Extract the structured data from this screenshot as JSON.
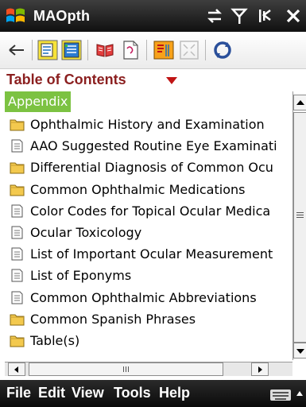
{
  "app": {
    "title": "MAOpth"
  },
  "toc": {
    "heading": "Table of Contents"
  },
  "list": {
    "selected": "Appendix",
    "items": [
      {
        "label": "Ophthalmic History and Examination",
        "icon": "folder-icon"
      },
      {
        "label": "AAO Suggested Routine Eye Examinati",
        "icon": "document-icon"
      },
      {
        "label": "Differential Diagnosis of Common Ocu",
        "icon": "folder-icon"
      },
      {
        "label": "Common Ophthalmic Medications",
        "icon": "folder-icon"
      },
      {
        "label": "Color Codes for Topical Ocular Medica",
        "icon": "document-icon"
      },
      {
        "label": "Ocular Toxicology",
        "icon": "document-icon"
      },
      {
        "label": "List of Important Ocular Measurement",
        "icon": "document-icon"
      },
      {
        "label": "List of Eponyms",
        "icon": "document-icon"
      },
      {
        "label": "Common Ophthalmic Abbreviations",
        "icon": "document-icon"
      },
      {
        "label": "Common Spanish Phrases",
        "icon": "folder-icon"
      },
      {
        "label": "Table(s)",
        "icon": "folder-icon"
      }
    ]
  },
  "menu": {
    "file": "File",
    "edit": "Edit",
    "view": "View",
    "tools": "Tools",
    "help": "Help"
  },
  "colors": {
    "selection": "#7cc242",
    "heading": "#8b1f1f",
    "folder": "#f3c94e"
  }
}
